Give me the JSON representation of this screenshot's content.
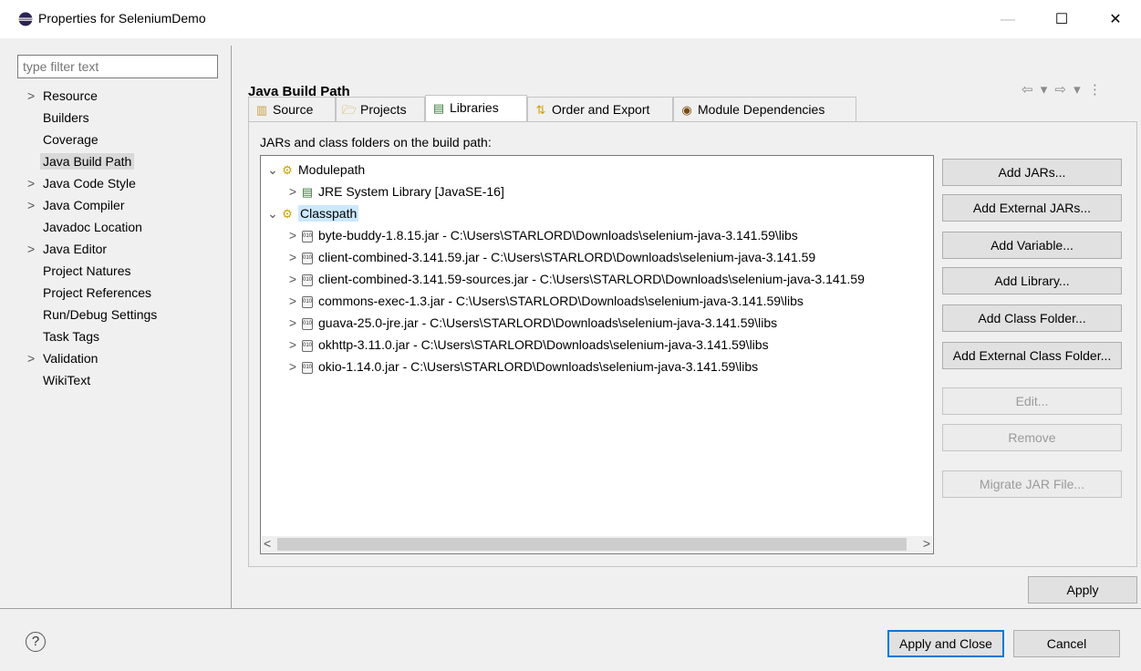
{
  "window": {
    "title": "Properties for SeleniumDemo",
    "minimize": "—",
    "maximize": "☐",
    "close": "✕"
  },
  "filter": {
    "placeholder": "type filter text"
  },
  "nav": {
    "items": [
      {
        "label": "Resource",
        "chevron": ">"
      },
      {
        "label": "Builders",
        "chevron": ""
      },
      {
        "label": "Coverage",
        "chevron": ""
      },
      {
        "label": "Java Build Path",
        "chevron": ""
      },
      {
        "label": "Java Code Style",
        "chevron": ">"
      },
      {
        "label": "Java Compiler",
        "chevron": ">"
      },
      {
        "label": "Javadoc Location",
        "chevron": ""
      },
      {
        "label": "Java Editor",
        "chevron": ">"
      },
      {
        "label": "Project Natures",
        "chevron": ""
      },
      {
        "label": "Project References",
        "chevron": ""
      },
      {
        "label": "Run/Debug Settings",
        "chevron": ""
      },
      {
        "label": "Task Tags",
        "chevron": ""
      },
      {
        "label": "Validation",
        "chevron": ">"
      },
      {
        "label": "WikiText",
        "chevron": ""
      }
    ]
  },
  "page": {
    "title": "Java Build Path",
    "history_nav": "⇦ ▾ ⇨ ▾ ⋮"
  },
  "tabs": [
    {
      "label": "Source",
      "icon": "source-folder-icon"
    },
    {
      "label": "Projects",
      "icon": "projects-folder-icon"
    },
    {
      "label": "Libraries",
      "icon": "libraries-icon"
    },
    {
      "label": "Order and Export",
      "icon": "order-export-icon"
    },
    {
      "label": "Module Dependencies",
      "icon": "module-icon"
    }
  ],
  "panel": {
    "label": "JARs and class folders on the build path:"
  },
  "tree": {
    "modulepath": {
      "label": "Modulepath",
      "arrow": "⌄"
    },
    "jre": {
      "label": "JRE System Library [JavaSE-16]",
      "arrow": ">"
    },
    "classpath": {
      "label": "Classpath",
      "arrow": "⌄"
    },
    "jars": [
      {
        "label": "byte-buddy-1.8.15.jar - C:\\Users\\STARLORD\\Downloads\\selenium-java-3.141.59\\libs"
      },
      {
        "label": "client-combined-3.141.59.jar - C:\\Users\\STARLORD\\Downloads\\selenium-java-3.141.59"
      },
      {
        "label": "client-combined-3.141.59-sources.jar - C:\\Users\\STARLORD\\Downloads\\selenium-java-3.141.59"
      },
      {
        "label": "commons-exec-1.3.jar - C:\\Users\\STARLORD\\Downloads\\selenium-java-3.141.59\\libs"
      },
      {
        "label": "guava-25.0-jre.jar - C:\\Users\\STARLORD\\Downloads\\selenium-java-3.141.59\\libs"
      },
      {
        "label": "okhttp-3.11.0.jar - C:\\Users\\STARLORD\\Downloads\\selenium-java-3.141.59\\libs"
      },
      {
        "label": "okio-1.14.0.jar - C:\\Users\\STARLORD\\Downloads\\selenium-java-3.141.59\\libs"
      }
    ],
    "jar_arrow": ">",
    "jar_icon_text": "010",
    "scroll_left": "<",
    "scroll_right": ">"
  },
  "buttons": {
    "add_jars": "Add JARs...",
    "add_external_jars": "Add External JARs...",
    "add_variable": "Add Variable...",
    "add_library": "Add Library...",
    "add_class_folder": "Add Class Folder...",
    "add_external_class_folder": "Add External Class Folder...",
    "edit": "Edit...",
    "remove": "Remove",
    "migrate_jar": "Migrate JAR File...",
    "apply": "Apply",
    "apply_and_close": "Apply and Close",
    "cancel": "Cancel",
    "help": "?"
  },
  "colors": {
    "selection": "#cce8ff",
    "nav_selection": "#d9d9d9",
    "focus_border": "#0078d7"
  }
}
